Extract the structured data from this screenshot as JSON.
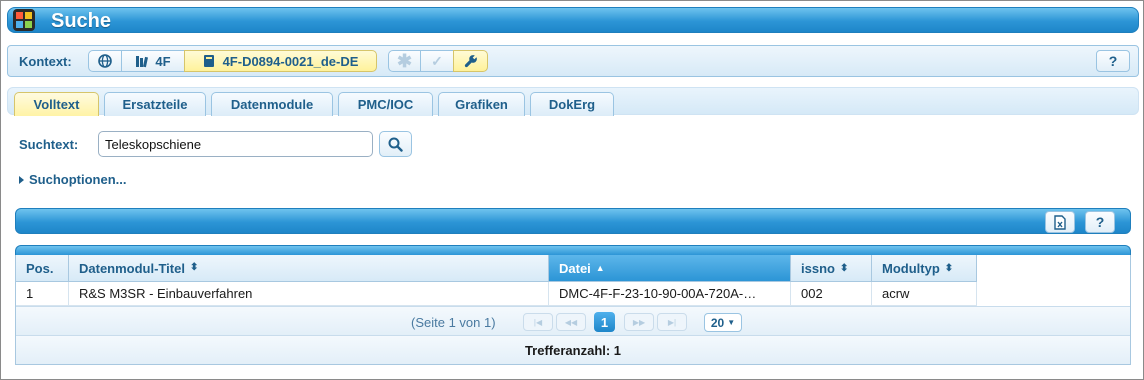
{
  "window": {
    "title": "Suche"
  },
  "context": {
    "label": "Kontext:",
    "project": "4F",
    "document": "4F-D0894-0021_de-DE",
    "help": "?"
  },
  "tabs": [
    {
      "label": "Volltext",
      "active": true
    },
    {
      "label": "Ersatzteile",
      "active": false
    },
    {
      "label": "Datenmodule",
      "active": false
    },
    {
      "label": "PMC/IOC",
      "active": false
    },
    {
      "label": "Grafiken",
      "active": false
    },
    {
      "label": "DokErg",
      "active": false
    }
  ],
  "search": {
    "label": "Suchtext:",
    "value": "Teleskopschiene",
    "options_label": "Suchoptionen..."
  },
  "results": {
    "help": "?",
    "columns": [
      "Pos.",
      "Datenmodul-Titel",
      "Datei",
      "issno",
      "Modultyp"
    ],
    "sorted_column": "Datei",
    "rows": [
      {
        "pos": "1",
        "title": "R&S M3SR - Einbauverfahren",
        "file": "DMC-4F-F-23-10-90-00A-720A-…",
        "issno": "002",
        "modultyp": "acrw"
      }
    ],
    "pager": {
      "info": "(Seite 1 von 1)",
      "current_page": "1",
      "page_size": "20"
    },
    "hit_count": "Trefferanzahl: 1"
  },
  "colors": {
    "accent_blue": "#2c95d6",
    "label_blue": "#1f5f8b",
    "active_tab_yellow": "#fff3a6"
  }
}
